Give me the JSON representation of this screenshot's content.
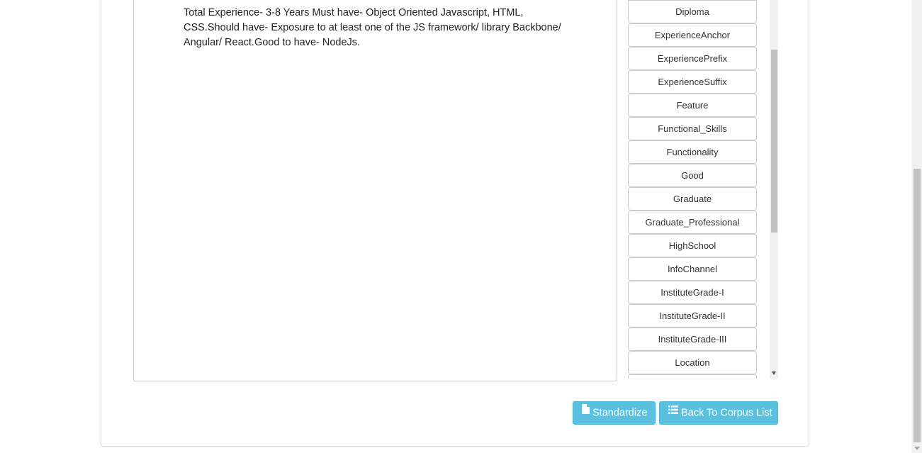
{
  "document": {
    "text": "Total Experience- 3-8 Years Must have- Object Oriented Javascript, HTML, CSS.Should have- Exposure to at least one of the JS framework/ library Backbone/ Angular/ React.Good to have- NodeJs."
  },
  "tags": [
    {
      "label": "Diploma"
    },
    {
      "label": "ExperienceAnchor"
    },
    {
      "label": "ExperiencePrefix"
    },
    {
      "label": "ExperienceSuffix"
    },
    {
      "label": "Feature"
    },
    {
      "label": "Functional_Skills"
    },
    {
      "label": "Functionality"
    },
    {
      "label": "Good"
    },
    {
      "label": "Graduate"
    },
    {
      "label": "Graduate_Professional"
    },
    {
      "label": "HighSchool"
    },
    {
      "label": "InfoChannel"
    },
    {
      "label": "InstituteGrade-I"
    },
    {
      "label": "InstituteGrade-II"
    },
    {
      "label": "InstituteGrade-III"
    },
    {
      "label": "Location"
    },
    {
      "label": ""
    }
  ],
  "actions": {
    "standardize_label": "Standardize",
    "standardize_icon": "file-icon",
    "back_label": "Back To Corpus List",
    "back_icon": "list-icon"
  },
  "colors": {
    "button_info": "#5bc0de",
    "button_info_border": "#46b8da"
  }
}
